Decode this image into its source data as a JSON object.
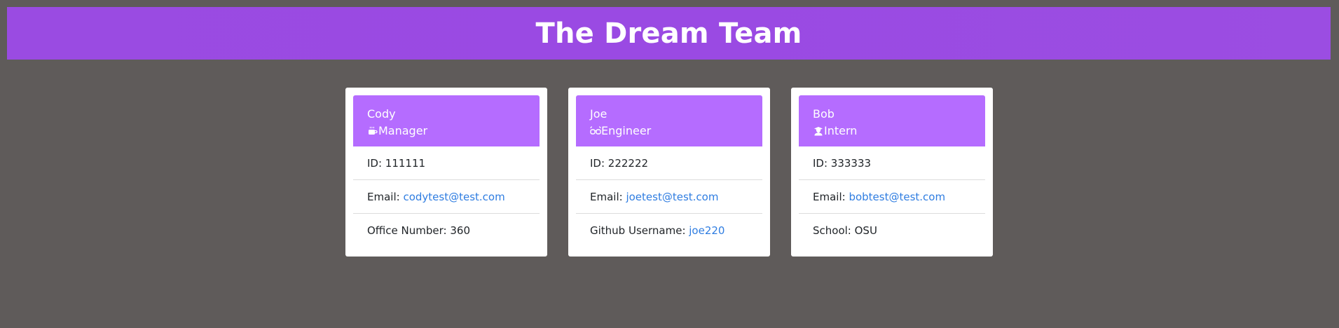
{
  "header": {
    "title": "The Dream Team"
  },
  "colors": {
    "banner": "#9a4be2",
    "card_header": "#b56cff",
    "background": "#5f5b5a",
    "link": "#2f7de1"
  },
  "cards": [
    {
      "name": "Cody",
      "role": "Manager",
      "role_icon": "coffee-mug-icon",
      "id_label": "ID: ",
      "id_value": "111111",
      "email_label": "Email: ",
      "email_value": "codytest@test.com",
      "extra_label": "Office Number: ",
      "extra_value": "360"
    },
    {
      "name": "Joe",
      "role": "Engineer",
      "role_icon": "glasses-icon",
      "id_label": "ID: ",
      "id_value": "222222",
      "email_label": "Email: ",
      "email_value": "joetest@test.com",
      "extra_label": "Github Username: ",
      "extra_value": "joe220"
    },
    {
      "name": "Bob",
      "role": "Intern",
      "role_icon": "graduate-icon",
      "id_label": "ID: ",
      "id_value": "333333",
      "email_label": "Email: ",
      "email_value": "bobtest@test.com",
      "extra_label": "School: ",
      "extra_value": "OSU"
    }
  ]
}
